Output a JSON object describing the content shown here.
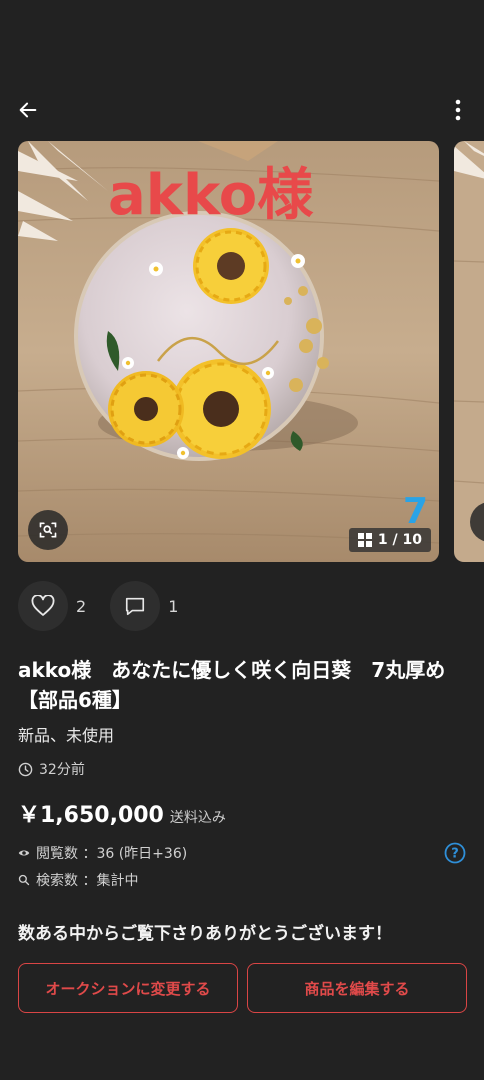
{
  "header": {
    "back_icon": "arrow-left-icon",
    "more_icon": "more-vertical-icon"
  },
  "gallery": {
    "overlay_text": "akko様",
    "overlay_text_color": "#e8494a",
    "number_mark": "7",
    "number_mark_color": "#2aa3e6",
    "counter_text": "1 / 10",
    "counter_icon": "grid-icon",
    "zoom_icon": "lens-search-icon"
  },
  "reactions": {
    "like_count": "2",
    "comment_count": "1"
  },
  "item": {
    "title": "akko様　あなたに優しく咲く向日葵　7丸厚め【部品6種】",
    "condition": "新品、未使用",
    "posted": "32分前",
    "price": "￥1,650,000",
    "shipping": "送料込み",
    "views_label": "閲覧数 ：36 (昨日+36)",
    "search_label": "検索数 ：集計中"
  },
  "message": "数ある中からご覧下さりありがとうございます！",
  "actions": {
    "auction_label": "オークションに変更する",
    "edit_label": "商品を編集する"
  },
  "colors": {
    "background": "#222222",
    "accent": "#d94545",
    "help": "#2f8fd8"
  }
}
